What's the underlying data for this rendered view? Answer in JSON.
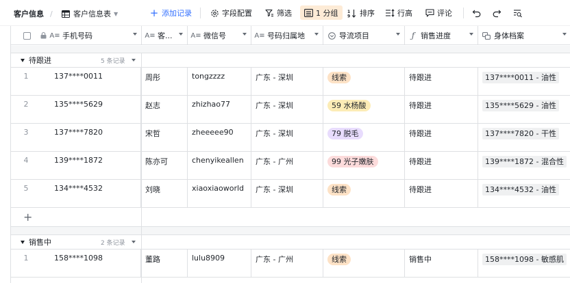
{
  "breadcrumb": {
    "root": "客户信息",
    "separator": "/",
    "table": "客户信息表"
  },
  "toolbar": {
    "add_record": "添加记录",
    "field_config": "字段配置",
    "filter": "筛选",
    "group": "1 分组",
    "sort": "排序",
    "row_height": "行高",
    "comment": "评论"
  },
  "columns": [
    {
      "label": "手机号码",
      "icon": "text-field-icon"
    },
    {
      "label": "客...",
      "icon": "text-field-icon"
    },
    {
      "label": "微信号",
      "icon": "text-field-icon"
    },
    {
      "label": "号码归属地",
      "icon": "text-field-icon"
    },
    {
      "label": "导流项目",
      "icon": "single-select-icon"
    },
    {
      "label": "销售进度",
      "icon": "formula-icon"
    },
    {
      "label": "身体档案",
      "icon": "link-record-icon"
    }
  ],
  "colors": {
    "accent": "#3370ff",
    "tag_orange": "#fde2c6",
    "tag_yellow": "#fcecb6",
    "tag_purple": "#e8dcfd",
    "tag_pink": "#fcdbdb"
  },
  "groups": [
    {
      "name": "待跟进",
      "count": "5 条记录",
      "rows": [
        {
          "index": "1",
          "phone": "137****0011",
          "name": "周彤",
          "wechat": "tongzzzz",
          "location": "广东 - 深圳",
          "project": "线索",
          "project_color": "#fde2c6",
          "stage": "待跟进",
          "profile": "137****0011 - 油性"
        },
        {
          "index": "2",
          "phone": "135****5629",
          "name": "赵志",
          "wechat": "zhizhao77",
          "location": "广东 - 深圳",
          "project": "59 水杨酸",
          "project_color": "#fcecb6",
          "stage": "待跟进",
          "profile": "135****5629 - 油性"
        },
        {
          "index": "3",
          "phone": "137****7820",
          "name": "宋哲",
          "wechat": "zheeeee90",
          "location": "广东 - 深圳",
          "project": "79 脱毛",
          "project_color": "#e8dcfd",
          "stage": "待跟进",
          "profile": "137****7820 - 干性"
        },
        {
          "index": "4",
          "phone": "139****1872",
          "name": "陈亦可",
          "wechat": "chenyikeallen",
          "location": "广东 - 广州",
          "project": "99 光子嫩肤",
          "project_color": "#fcdbdb",
          "stage": "待跟进",
          "profile": "139****1872 - 混合性"
        },
        {
          "index": "5",
          "phone": "134****4532",
          "name": "刘晓",
          "wechat": "xiaoxiaoworld",
          "location": "广东 - 深圳",
          "project": "线索",
          "project_color": "#fde2c6",
          "stage": "待跟进",
          "profile": "134****4532 - 油性"
        }
      ]
    },
    {
      "name": "销售中",
      "count": "2 条记录",
      "rows": [
        {
          "index": "1",
          "phone": "158****1098",
          "name": "董路",
          "wechat": "lulu8909",
          "location": "广东 - 广州",
          "project": "线索",
          "project_color": "#fde2c6",
          "stage": "销售中",
          "profile": "158****1098 - 敏感肌"
        }
      ]
    }
  ],
  "add_row_symbol": "+"
}
